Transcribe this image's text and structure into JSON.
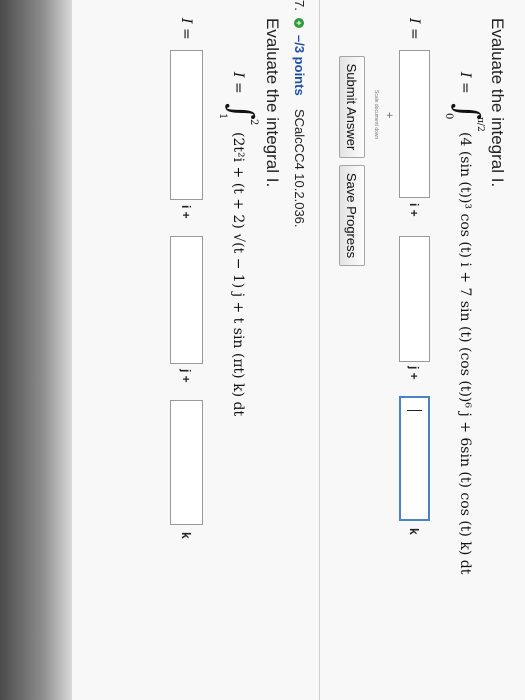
{
  "problem1": {
    "heading": "Evaluate the integral I.",
    "integral_lhs": "I =",
    "lower_limit": "0",
    "upper_limit": "π/2",
    "integrand": "(4 (sin (t))³ cos (t) i + 7 sin (t) (cos (t))⁶ j + 6sin (t) cos (t) k) dt",
    "answer_label": "I =",
    "i_label": "i +",
    "j_label": "j +",
    "k_label": "k",
    "crosshair": "+",
    "scale_hint": "Scale document down"
  },
  "buttons": {
    "submit": "Submit Answer",
    "save": "Save Progress"
  },
  "problem2": {
    "number": "7.",
    "points": "–/3 points",
    "code": "SCalcCC4 10.2.036.",
    "heading": "Evaluate the integral I.",
    "integral_lhs": "I =",
    "lower_limit": "1",
    "upper_limit": "2",
    "integrand": "(2t²i + (t + 2) √(t − 1) j + t sin (πt) k) dt",
    "answer_label": "I =",
    "i_label": "i +",
    "j_label": "j +",
    "k_label": "k"
  },
  "colors": {
    "active_border": "#4a84c7",
    "points_blue": "#1d4fa8",
    "status_green": "#2f9a3a"
  },
  "icons": {
    "status": "plus-circle-icon",
    "crosshair": "crosshair-icon"
  }
}
